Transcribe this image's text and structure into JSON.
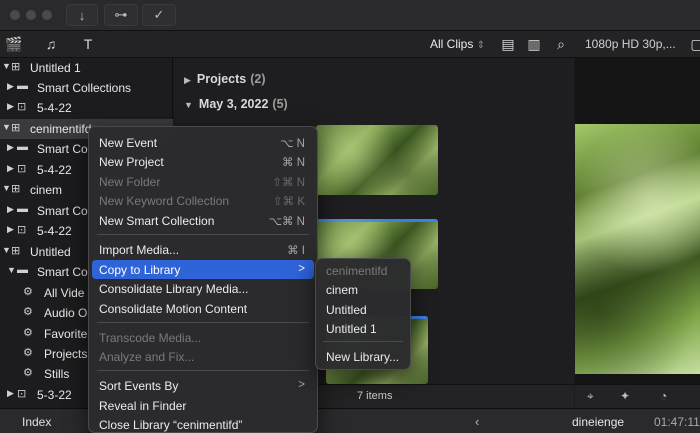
{
  "toolbar": {
    "download_icon": "download-icon",
    "key_icon": "key-icon",
    "check_icon": "checkmark-icon"
  },
  "browser_toolbar": {
    "filter_label": "All Clips",
    "preview_format": "1080p HD 30p,..."
  },
  "sidebar": {
    "items": [
      {
        "label": "Untitled 1",
        "kind": "library"
      },
      {
        "label": "Smart Collections",
        "kind": "folder"
      },
      {
        "label": "5-4-22",
        "kind": "event"
      },
      {
        "label": "cenimentifd",
        "kind": "library"
      },
      {
        "label": "Smart Co",
        "kind": "folder"
      },
      {
        "label": "5-4-22",
        "kind": "event"
      },
      {
        "label": "cinem",
        "kind": "library"
      },
      {
        "label": "Smart Co",
        "kind": "folder"
      },
      {
        "label": "5-4-22",
        "kind": "event"
      },
      {
        "label": "Untitled",
        "kind": "library"
      },
      {
        "label": "Smart Co",
        "kind": "folder"
      },
      {
        "label": "All Vide",
        "kind": "smart"
      },
      {
        "label": "Audio O",
        "kind": "smart"
      },
      {
        "label": "Favorite",
        "kind": "smart"
      },
      {
        "label": "Projects",
        "kind": "smart"
      },
      {
        "label": "Stills",
        "kind": "smart"
      },
      {
        "label": "5-3-22",
        "kind": "event"
      }
    ]
  },
  "browser": {
    "projects_label": "Projects",
    "projects_count": "(2)",
    "date_label": "May 3, 2022",
    "date_count": "(5)",
    "items_count": "7 items"
  },
  "context_menu": {
    "items": [
      {
        "label": "New Event",
        "shortcut": "⌥ N",
        "disabled": false
      },
      {
        "label": "New Project",
        "shortcut": "⌘ N",
        "disabled": false
      },
      {
        "label": "New Folder",
        "shortcut": "⇧⌘ N",
        "disabled": true
      },
      {
        "label": "New Keyword Collection",
        "shortcut": "⇧⌘ K",
        "disabled": true
      },
      {
        "label": "New Smart Collection",
        "shortcut": "⌥⌘ N",
        "disabled": false
      },
      {
        "label": "Import Media...",
        "shortcut": "⌘ I",
        "disabled": false
      },
      {
        "label": "Copy to Library",
        "shortcut": ">",
        "disabled": false
      },
      {
        "label": "Consolidate Library Media...",
        "shortcut": "",
        "disabled": false
      },
      {
        "label": "Consolidate Motion Content",
        "shortcut": "",
        "disabled": false
      },
      {
        "label": "Transcode Media...",
        "shortcut": "",
        "disabled": true
      },
      {
        "label": "Analyze and Fix...",
        "shortcut": "",
        "disabled": true
      },
      {
        "label": "Sort Events By",
        "shortcut": ">",
        "disabled": false
      },
      {
        "label": "Reveal in Finder",
        "shortcut": "",
        "disabled": false
      },
      {
        "label": "Close Library “cenimentifd”",
        "shortcut": "",
        "disabled": false
      }
    ]
  },
  "submenu": {
    "items": [
      {
        "label": "cenimentifd",
        "disabled": true
      },
      {
        "label": "cinem",
        "disabled": false
      },
      {
        "label": "Untitled",
        "disabled": false
      },
      {
        "label": "Untitled 1",
        "disabled": false
      },
      {
        "label": "New Library...",
        "disabled": false
      }
    ]
  },
  "bottombar": {
    "index_label": "Index",
    "project_name": "dineienge",
    "timecode": "01:47:11"
  },
  "colors": {
    "highlight": "#2f63d8",
    "clip_bar": "#3b82e6"
  }
}
